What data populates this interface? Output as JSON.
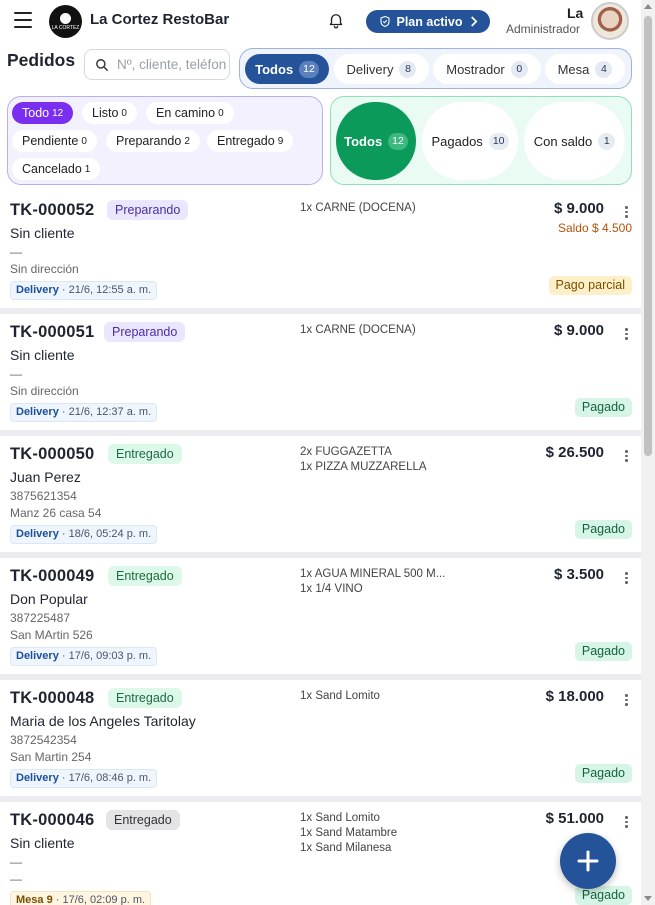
{
  "header": {
    "app_name": "La Cortez RestoBar",
    "logo_text": "LA CORTEZ",
    "plan_label": "Plan activo",
    "user_name": "La",
    "user_role": "Administrador"
  },
  "page": {
    "title": "Pedidos",
    "search_placeholder": "Nº, cliente, teléfono"
  },
  "channels": [
    {
      "label": "Todos",
      "count": "12",
      "active": true
    },
    {
      "label": "Delivery",
      "count": "8",
      "active": false
    },
    {
      "label": "Mostrador",
      "count": "0",
      "active": false
    },
    {
      "label": "Mesa",
      "count": "4",
      "active": false
    }
  ],
  "statuses": [
    {
      "label": "Todo",
      "count": "12",
      "active": true
    },
    {
      "label": "Listo",
      "count": "0",
      "active": false
    },
    {
      "label": "En camino",
      "count": "0",
      "active": false
    },
    {
      "label": "Pendiente",
      "count": "0",
      "active": false
    },
    {
      "label": "Preparando",
      "count": "2",
      "active": false
    },
    {
      "label": "Entregado",
      "count": "9",
      "active": false
    },
    {
      "label": "Cancelado",
      "count": "1",
      "active": false
    }
  ],
  "payments": [
    {
      "label": "Todos",
      "count": "12",
      "active": true
    },
    {
      "label": "Pagados",
      "count": "10",
      "active": false
    },
    {
      "label": "Con saldo",
      "count": "1",
      "active": false
    }
  ],
  "orders": [
    {
      "id": "TK-000052",
      "status": "Preparando",
      "customer": "Sin cliente",
      "phone": "—",
      "address": "Sin dirección",
      "channel": "Delivery",
      "datetime": "21/6, 12:55 a. m.",
      "items": [
        "1x CARNE (DOCENA)"
      ],
      "total": "$ 9.000",
      "saldo": "Saldo $ 4.500",
      "payment": "Pago parcial"
    },
    {
      "id": "TK-000051",
      "status": "Preparando",
      "customer": "Sin cliente",
      "phone": "—",
      "address": "Sin dirección",
      "channel": "Delivery",
      "datetime": "21/6, 12:37 a. m.",
      "items": [
        "1x CARNE (DOCENA)"
      ],
      "total": "$ 9.000",
      "saldo": "",
      "payment": "Pagado"
    },
    {
      "id": "TK-000050",
      "status": "Entregado",
      "customer": "Juan Perez",
      "phone": "3875621354",
      "address": "Manz 26 casa 54",
      "channel": "Delivery",
      "datetime": "18/6, 05:24 p. m.",
      "items": [
        "2x FUGGAZETTA",
        "1x PIZZA MUZZARELLA"
      ],
      "total": "$ 26.500",
      "saldo": "",
      "payment": "Pagado"
    },
    {
      "id": "TK-000049",
      "status": "Entregado",
      "customer": "Don Popular",
      "phone": "387225487",
      "address": "San MArtin 526",
      "channel": "Delivery",
      "datetime": "17/6, 09:03 p. m.",
      "items": [
        "1x AGUA MINERAL 500 M...",
        "1x 1/4 VINO"
      ],
      "total": "$ 3.500",
      "saldo": "",
      "payment": "Pagado"
    },
    {
      "id": "TK-000048",
      "status": "Entregado",
      "customer": "Maria de los Angeles Taritolay",
      "phone": "3872542354",
      "address": "San Martin 254",
      "channel": "Delivery",
      "datetime": "17/6, 08:46 p. m.",
      "items": [
        "1x Sand Lomito"
      ],
      "total": "$ 18.000",
      "saldo": "",
      "payment": "Pagado"
    },
    {
      "id": "TK-000046",
      "status": "Entregado",
      "customer": "Sin cliente",
      "phone": "—",
      "address": "—",
      "channel": "Mesa 9",
      "datetime": "17/6, 02:09 p. m.",
      "items": [
        "1x Sand Lomito",
        "1x Sand Matambre",
        "1x Sand Milanesa"
      ],
      "total": "$ 51.000",
      "saldo": "",
      "payment": "Pagado"
    }
  ],
  "colors": {
    "primary": "#24539a",
    "status_accent": "#7a2ff0",
    "payment_accent": "#0b9a5a"
  },
  "icons": {
    "menu": "hamburger-icon",
    "notifications": "bell-icon",
    "plan": "shield-icon",
    "search": "search-icon",
    "more": "kebab-icon",
    "add": "plus-icon"
  }
}
